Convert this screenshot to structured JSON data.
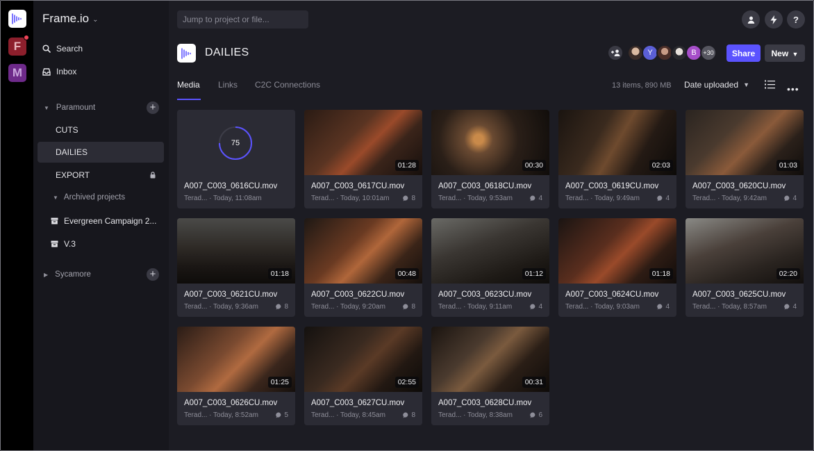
{
  "app": {
    "brand": "Frame.io"
  },
  "workspaces": [
    {
      "letter": ""
    },
    {
      "letter": "F",
      "has_notification": true
    },
    {
      "letter": "M"
    }
  ],
  "sidebar": {
    "search_label": "Search",
    "inbox_label": "Inbox",
    "teams": [
      {
        "name": "Paramount",
        "expanded": true
      },
      {
        "name": "Sycamore",
        "expanded": false
      }
    ],
    "projects": [
      {
        "name": "CUTS"
      },
      {
        "name": "DAILIES",
        "active": true
      },
      {
        "name": "EXPORT",
        "locked": true
      }
    ],
    "archived_label": "Archived projects",
    "archived": [
      {
        "name": "Evergreen Campaign 2..."
      },
      {
        "name": "V.3"
      }
    ]
  },
  "header": {
    "search_placeholder": "Jump to project or file...",
    "project_title": "DAILIES",
    "collaborators": [
      {
        "type": "initial",
        "initial": "Y",
        "color": "#5b5fd6"
      },
      {
        "type": "initial",
        "initial": "B",
        "color": "#a64ec9"
      }
    ],
    "extra_collaborators": "+30",
    "share_label": "Share",
    "new_label": "New"
  },
  "tabs": [
    {
      "label": "Media",
      "active": true
    },
    {
      "label": "Links"
    },
    {
      "label": "C2C Connections"
    }
  ],
  "toolbar": {
    "count": "13 items, 890 MB",
    "sort_label": "Date uploaded"
  },
  "accent_color": "#5b53ff",
  "assets": [
    {
      "name": "A007_C003_0616CU.mov",
      "meta": "Terad... · Today, 11:08am",
      "progress": 75
    },
    {
      "name": "A007_C003_0617CU.mov",
      "meta": "Terad... · Today, 10:01am",
      "duration": "01:28",
      "comments": "8"
    },
    {
      "name": "A007_C003_0618CU.mov",
      "meta": "Terad... · Today, 9:53am",
      "duration": "00:30",
      "comments": "4"
    },
    {
      "name": "A007_C003_0619CU.mov",
      "meta": "Terad... · Today, 9:49am",
      "duration": "02:03",
      "comments": "4"
    },
    {
      "name": "A007_C003_0620CU.mov",
      "meta": "Terad... · Today, 9:42am",
      "duration": "01:03",
      "comments": "4"
    },
    {
      "name": "A007_C003_0621CU.mov",
      "meta": "Terad... · Today, 9:36am",
      "duration": "01:18",
      "comments": "8"
    },
    {
      "name": "A007_C003_0622CU.mov",
      "meta": "Terad... · Today, 9:20am",
      "duration": "00:48",
      "comments": "8"
    },
    {
      "name": "A007_C003_0623CU.mov",
      "meta": "Terad... · Today, 9:11am",
      "duration": "01:12",
      "comments": "4"
    },
    {
      "name": "A007_C003_0624CU.mov",
      "meta": "Terad... · Today, 9:03am",
      "duration": "01:18",
      "comments": "4"
    },
    {
      "name": "A007_C003_0625CU.mov",
      "meta": "Terad... · Today, 8:57am",
      "duration": "02:20",
      "comments": "4"
    },
    {
      "name": "A007_C003_0626CU.mov",
      "meta": "Terad... · Today, 8:52am",
      "duration": "01:25",
      "comments": "5"
    },
    {
      "name": "A007_C003_0627CU.mov",
      "meta": "Terad... · Today, 8:45am",
      "duration": "02:55",
      "comments": "8"
    },
    {
      "name": "A007_C003_0628CU.mov",
      "meta": "Terad... · Today, 8:38am",
      "duration": "00:31",
      "comments": "6"
    }
  ]
}
